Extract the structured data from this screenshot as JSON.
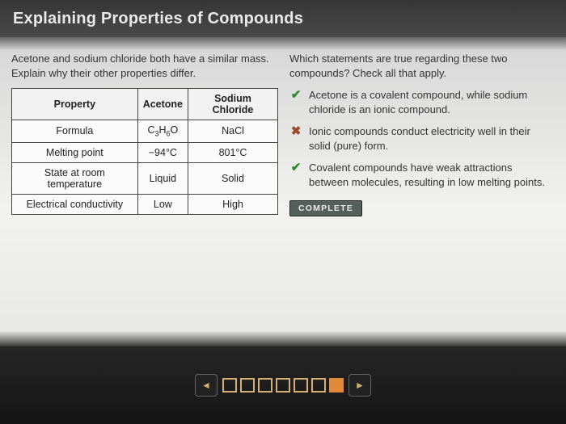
{
  "header": {
    "title": "Explaining Properties of Compounds"
  },
  "left": {
    "lead": "Acetone and sodium chloride both have a similar mass. Explain why their other properties differ.",
    "table": {
      "headers": [
        "Property",
        "Acetone",
        "Sodium Chloride"
      ],
      "rows": [
        {
          "property": "Formula",
          "acetone": "C3H6O",
          "acetone_formula": true,
          "nacl": "NaCl"
        },
        {
          "property": "Melting point",
          "acetone": "−94°C",
          "nacl": "801°C"
        },
        {
          "property": "State at room temperature",
          "acetone": "Liquid",
          "nacl": "Solid"
        },
        {
          "property": "Electrical conductivity",
          "acetone": "Low",
          "nacl": "High"
        }
      ]
    }
  },
  "right": {
    "question": "Which statements are true regarding these two compounds? Check all that apply.",
    "choices": [
      {
        "mark": "check",
        "text": "Acetone is a covalent compound, while sodium chloride is an ionic compound."
      },
      {
        "mark": "cross",
        "text": "Ionic compounds conduct electricity well in their solid (pure) form."
      },
      {
        "mark": "check",
        "text": "Covalent compounds have weak attractions between molecules, resulting in low melting points."
      }
    ],
    "complete_label": "COMPLETE"
  },
  "nav": {
    "prev_glyph": "◄",
    "next_glyph": "►",
    "slides": 7,
    "active_index": 6
  },
  "icons": {
    "check_glyph": "✔",
    "cross_glyph": "✖"
  }
}
